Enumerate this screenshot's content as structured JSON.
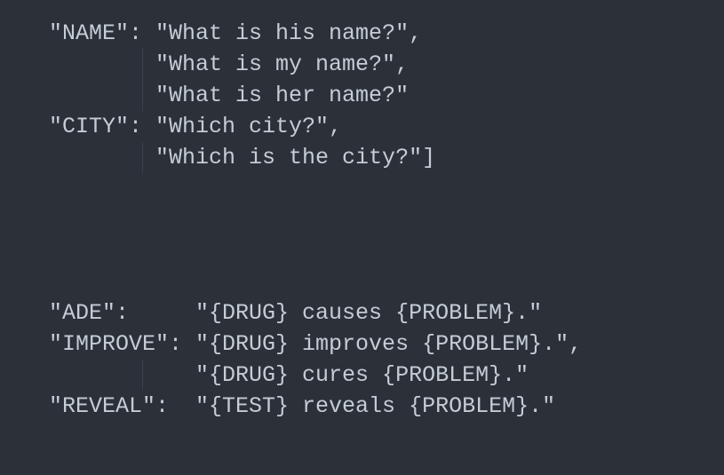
{
  "lines": {
    "l1": "\"NAME\": \"What is his name?\",",
    "l2": "        \"What is my name?\",",
    "l3": "        \"What is her name?\"",
    "l4": "\"CITY\": \"Which city?\",",
    "l5": "        \"Which is the city?\"]",
    "l6": "\"ADE\":     \"{DRUG} causes {PROBLEM}.\"",
    "l7": "\"IMPROVE\": \"{DRUG} improves {PROBLEM}.\",",
    "l8": "           \"{DRUG} cures {PROBLEM}.\"",
    "l9": "\"REVEAL\":  \"{TEST} reveals {PROBLEM}.\""
  }
}
